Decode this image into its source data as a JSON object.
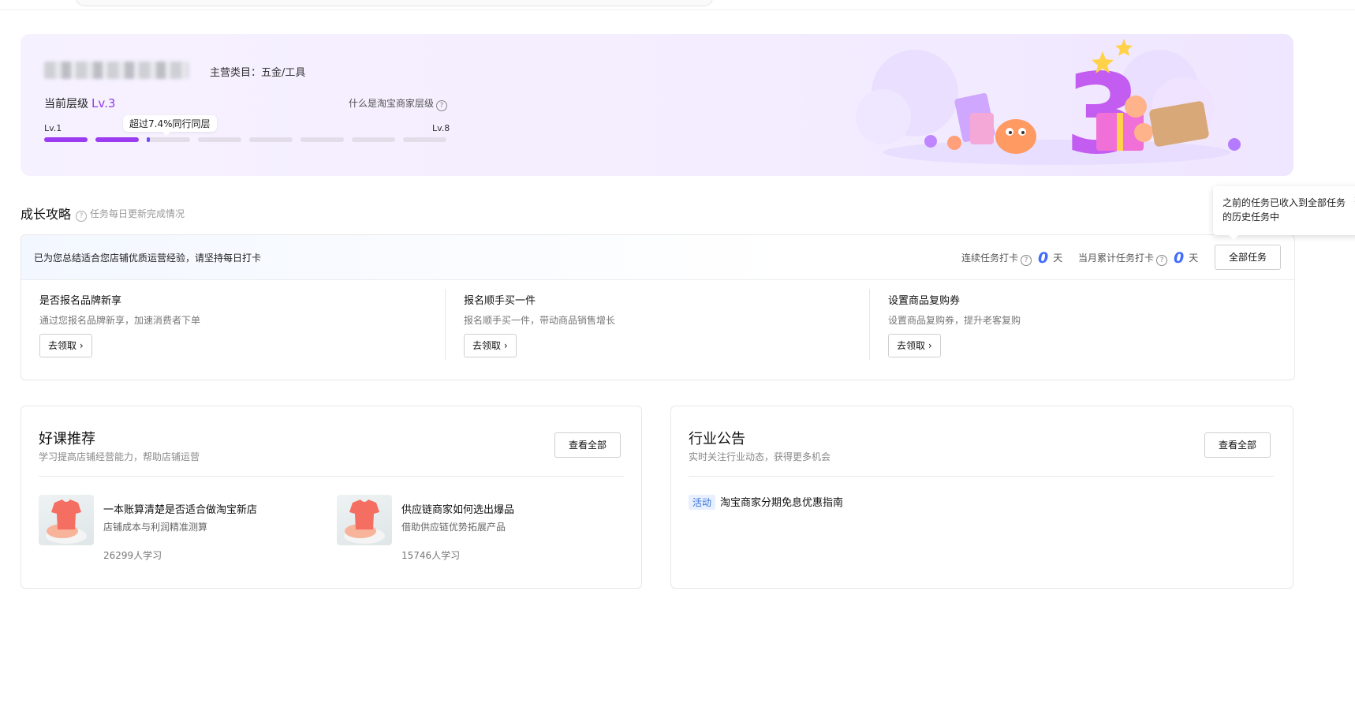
{
  "banner": {
    "category": "主营类目：五金/工具",
    "current_level_label": "当前层级",
    "current_level": "Lv.3",
    "what_is_level": "什么是淘宝商家层级",
    "beat_tip": "超过7.4%同行同层",
    "level_start": "Lv.1",
    "level_end": "Lv.8",
    "progress_segments_total": 8,
    "progress_segments_completed": 2,
    "current_segment_progress": 0.074,
    "illustration_number": "3",
    "accent_color": "#9b3cf0"
  },
  "growth": {
    "title": "成长攻略",
    "subtitle": "任务每日更新完成情况",
    "note": "已为您总结适合您店铺优质运营经验，请坚持每日打卡",
    "streak_label": "连续任务打卡",
    "streak_value": "0",
    "month_label": "当月累计任务打卡",
    "month_value": "0",
    "day_unit": "天",
    "all_tasks_button": "全部任务",
    "popover": "之前的任务已收入到全部任务的历史任务中",
    "tasks": [
      {
        "title": "是否报名品牌新享",
        "desc": "通过您报名品牌新享，加速消费者下单",
        "button": "去领取"
      },
      {
        "title": "报名顺手买一件",
        "desc": "报名顺手买一件，带动商品销售增长",
        "button": "去领取"
      },
      {
        "title": "设置商品复购券",
        "desc": "设置商品复购券，提升老客复购",
        "button": "去领取"
      }
    ]
  },
  "courses": {
    "title": "好课推荐",
    "subtitle": "学习提高店铺经营能力，帮助店铺运营",
    "view_all": "查看全部",
    "items": [
      {
        "title": "一本账算清楚是否适合做淘宝新店",
        "desc": "店铺成本与利润精准测算",
        "learners": "26299人学习"
      },
      {
        "title": "供应链商家如何选出爆品",
        "desc": "借助供应链优势拓展产品",
        "learners": "15746人学习"
      }
    ]
  },
  "news": {
    "title": "行业公告",
    "subtitle": "实时关注行业动态，获得更多机会",
    "view_all": "查看全部",
    "items": [
      {
        "tag": "活动",
        "title": "淘宝商家分期免息优惠指南"
      }
    ]
  }
}
